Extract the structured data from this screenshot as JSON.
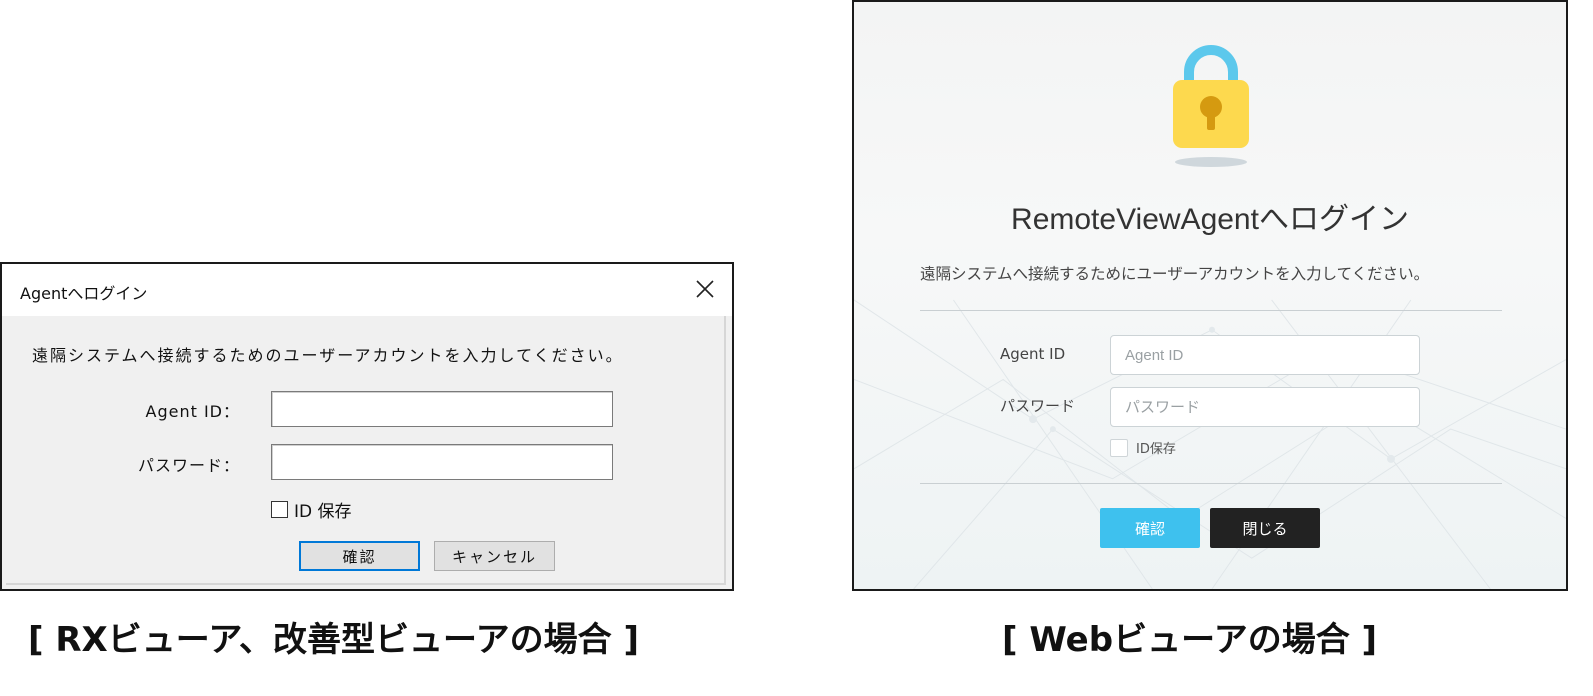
{
  "rx_dialog": {
    "title": "Agentへログイン",
    "close_icon": "close-icon",
    "description": "遠隔システムへ接続するためのユーザーアカウントを入力してください。",
    "agent_id_label": "Agent ID：",
    "password_label": "パスワード：",
    "agent_id_value": "",
    "password_value": "",
    "save_id_label": "ID 保存",
    "save_id_checked": false,
    "confirm_label": "確認",
    "cancel_label": "キャンセル"
  },
  "web_dialog": {
    "lock_icon": "lock-icon",
    "title": "RemoteViewAgentへログイン",
    "description": "遠隔システムへ接続するためにユーザーアカウントを入力してください。",
    "agent_id_label": "Agent ID",
    "agent_id_placeholder": "Agent ID",
    "password_label": "パスワード",
    "password_placeholder": "パスワード",
    "save_id_label": "ID保存",
    "save_id_checked": false,
    "confirm_label": "確認",
    "close_label": "閉じる",
    "colors": {
      "confirm": "#3ec1ee",
      "close": "#222222",
      "lock_body": "#fdd94e",
      "lock_shackle": "#5cc8ec"
    }
  },
  "captions": {
    "left": "[ RXビューア、改善型ビューアの場合 ]",
    "right": "[ Webビューアの場合 ]"
  }
}
